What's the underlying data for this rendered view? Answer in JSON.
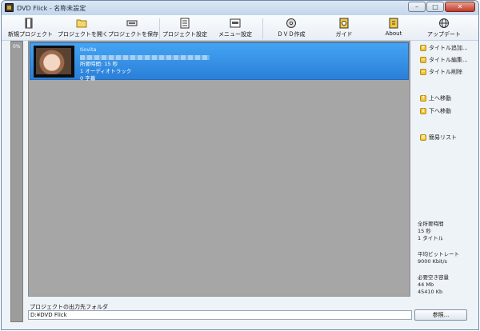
{
  "window": {
    "title": "DVD Flick - 名称未設定"
  },
  "title_controls": {
    "minimize": "–",
    "maximize": "□",
    "close": "✕"
  },
  "toolbar": {
    "new_project": "新規プロジェクト",
    "open_project": "プロジェクトを開く",
    "save_project": "プロジェクトを保存",
    "project_settings": "プロジェクト設定",
    "menu_settings": "メニュー設定",
    "create_dvd": "ＤＶＤ作成",
    "guide": "ガイド",
    "about": "About",
    "update": "アップデート"
  },
  "progress": {
    "label": "0%"
  },
  "title_item": {
    "name": "tiovita",
    "duration": "所要時間: 15 秒",
    "audio": "1 オーディオトラック",
    "subtitles": "0 字幕"
  },
  "side": {
    "add_title": "タイトル追加...",
    "edit_title": "タイトル編集...",
    "delete_title": "タイトル削除",
    "move_up": "上へ移動",
    "move_down": "下へ移動",
    "simple_list": "簡易リスト"
  },
  "stats": {
    "total_label": "全所要時間",
    "total_time": "15 秒",
    "total_titles": "1 タイトル",
    "bitrate_label": "平均ビットレート",
    "bitrate_value": "9000 Kbit/s",
    "size_label": "必要空き容量",
    "size_mb": "44 Mb",
    "size_kb": "45410 Kb"
  },
  "output": {
    "label": "プロジェクトの出力先フォルダ",
    "path": "D:¥DVD Flick",
    "browse": "参照..."
  },
  "colors": {
    "selection": "#2a7fd8",
    "list_bg": "#a6a6a6",
    "toolbar_bg": "#eef3f8"
  }
}
